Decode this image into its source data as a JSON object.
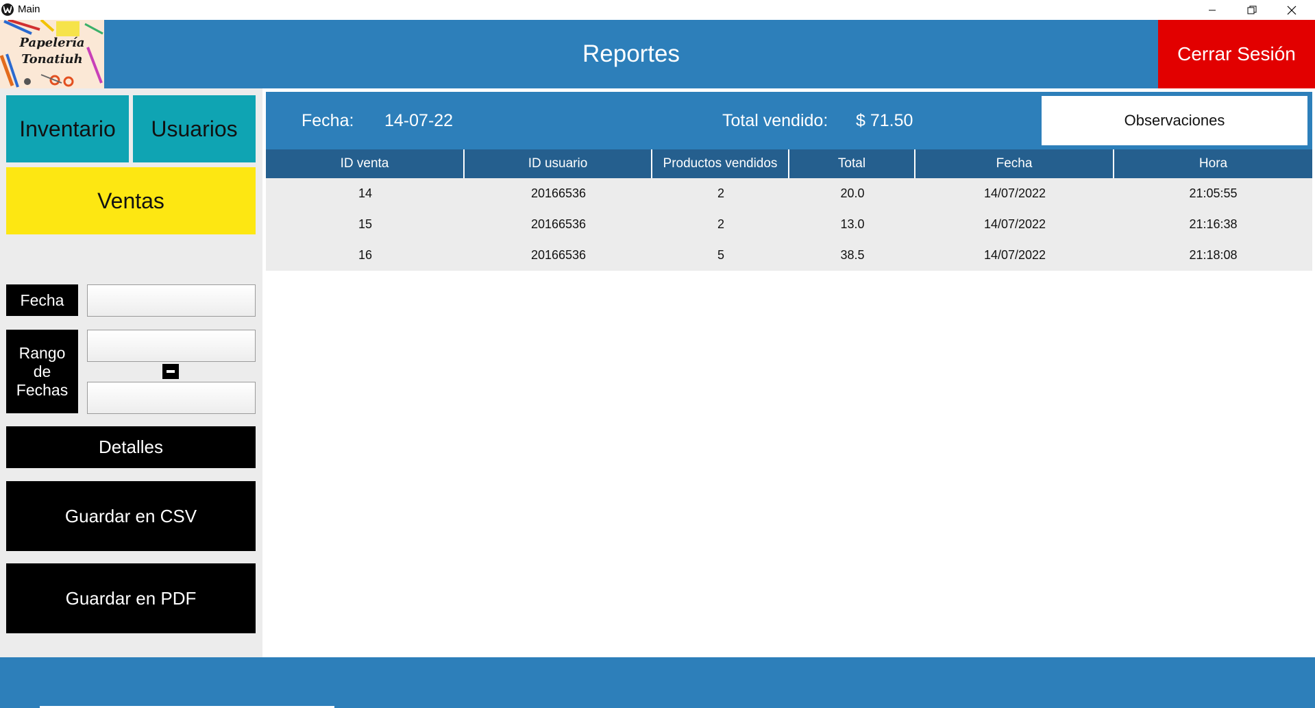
{
  "window": {
    "title": "Main"
  },
  "header": {
    "logo_text_line1": "Papelería",
    "logo_text_line2": "Tonatiuh",
    "title": "Reportes",
    "logout_label": "Cerrar Sesión"
  },
  "sidebar": {
    "nav": {
      "inventario": "Inventario",
      "usuarios": "Usuarios",
      "ventas": "Ventas"
    },
    "fecha_label": "Fecha",
    "rango_line1": "Rango",
    "rango_line2": "de",
    "rango_line3": "Fechas",
    "inputs": {
      "fecha": "",
      "desde": "",
      "hasta": ""
    },
    "detalles_label": "Detalles",
    "csv_label": "Guardar en CSV",
    "pdf_label": "Guardar en PDF"
  },
  "summary": {
    "fecha_label": "Fecha:",
    "fecha_value": "14-07-22",
    "total_label": "Total vendido:",
    "total_value": "$ 71.50",
    "observaciones_label": "Observaciones"
  },
  "table": {
    "headers": [
      "ID venta",
      "ID usuario",
      "Productos vendidos",
      "Total",
      "Fecha",
      "Hora"
    ],
    "rows": [
      [
        "14",
        "20166536",
        "2",
        "20.0",
        "14/07/2022",
        "21:05:55"
      ],
      [
        "15",
        "20166536",
        "2",
        "13.0",
        "14/07/2022",
        "21:16:38"
      ],
      [
        "16",
        "20166536",
        "5",
        "38.5",
        "14/07/2022",
        "21:18:08"
      ]
    ]
  },
  "colors": {
    "header_blue": "#2d7fba",
    "table_header": "#255f8e",
    "logout_red": "#e20000",
    "nav_teal": "#0fa4b3",
    "nav_yellow": "#fde712"
  },
  "icons": [
    "app-icon",
    "minimize-icon",
    "maximize-icon",
    "close-icon",
    "minus-icon"
  ]
}
